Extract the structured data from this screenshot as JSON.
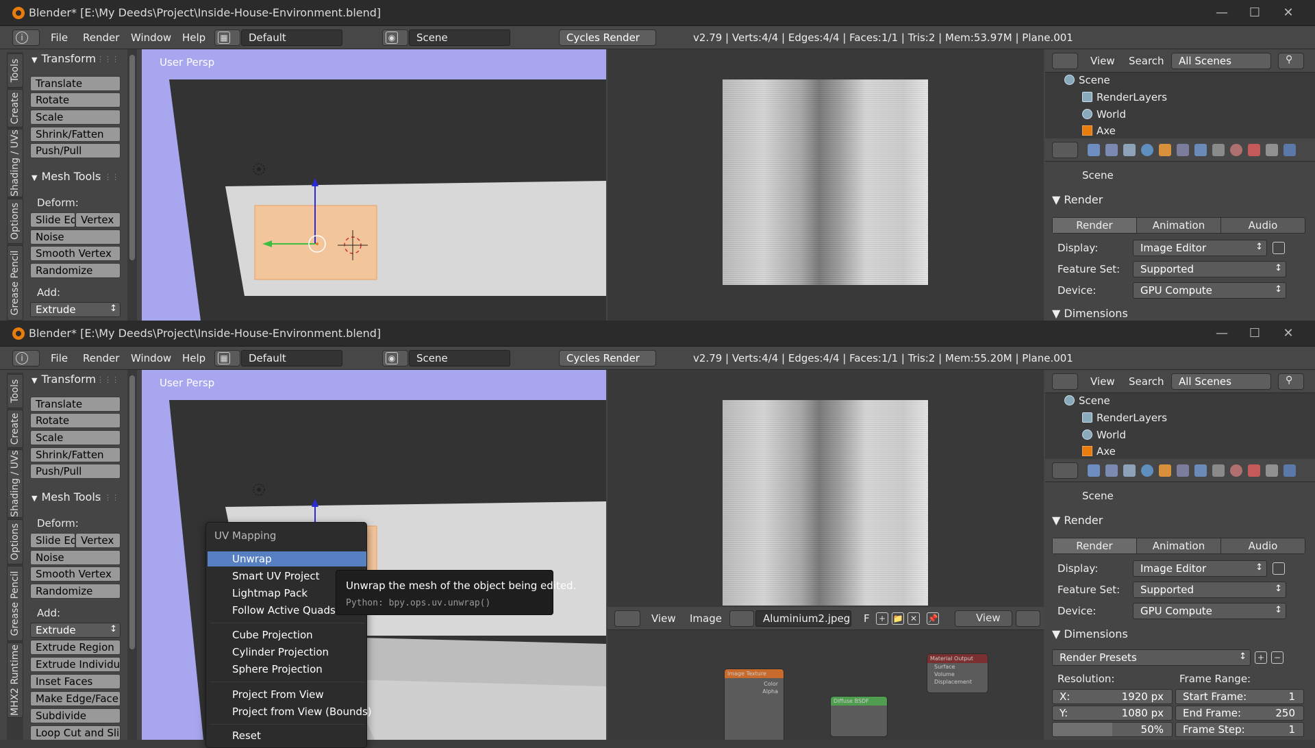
{
  "window1": {
    "title": "Blender* [E:\\My Deeds\\Project\\Inside-House-Environment.blend]",
    "menu": [
      "File",
      "Render",
      "Window",
      "Help"
    ],
    "layout": "Default",
    "scene": "Scene",
    "engine": "Cycles Render",
    "stats": "v2.79 | Verts:4/4 | Edges:4/4 | Faces:1/1 | Tris:2 | Mem:53.97M | Plane.001"
  },
  "window2": {
    "title": "Blender* [E:\\My Deeds\\Project\\Inside-House-Environment.blend]",
    "menu": [
      "File",
      "Render",
      "Window",
      "Help"
    ],
    "layout": "Default",
    "scene": "Scene",
    "engine": "Cycles Render",
    "stats": "v2.79 | Verts:4/4 | Edges:4/4 | Faces:1/1 | Tris:2 | Mem:55.20M | Plane.001"
  },
  "tool_tabs": [
    "Tools",
    "Create",
    "Shading / UVs",
    "Options",
    "Grease Pencil",
    "MHX2 Runtime"
  ],
  "tool_shelf": {
    "transform_header": "Transform",
    "transform_buttons": [
      "Translate",
      "Rotate",
      "Scale",
      "Shrink/Fatten",
      "Push/Pull"
    ],
    "mesh_tools_header": "Mesh Tools",
    "deform_label": "Deform:",
    "slide_edge": "Slide Ed",
    "vertex": "Vertex",
    "deform_buttons": [
      "Noise",
      "Smooth Vertex",
      "Randomize"
    ],
    "add_label": "Add:",
    "extrude": "Extrude",
    "add_buttons": [
      "Extrude Region",
      "Extrude Individual",
      "Inset Faces",
      "Make Edge/Face",
      "Subdivide",
      "Loop Cut and Sli..."
    ]
  },
  "viewport": {
    "label": "User Persp"
  },
  "outliner": {
    "view": "View",
    "search": "Search",
    "filter": "All Scenes",
    "rows": [
      "Scene",
      "RenderLayers",
      "World",
      "Axe"
    ]
  },
  "properties": {
    "context": "Scene",
    "render_section": "Render",
    "tabs": [
      "Render",
      "Animation",
      "Audio"
    ],
    "display_label": "Display:",
    "display_value": "Image Editor",
    "feature_set_label": "Feature Set:",
    "feature_set_value": "Supported",
    "device_label": "Device:",
    "device_value": "GPU Compute",
    "dimensions_section": "Dimensions",
    "render_presets": "Render Presets",
    "resolution_label": "Resolution:",
    "res_x_label": "X:",
    "res_x_value": "1920 px",
    "res_y_label": "Y:",
    "res_y_value": "1080 px",
    "res_pct": "50%",
    "frame_range_label": "Frame Range:",
    "start_frame_label": "Start Frame:",
    "start_frame_value": "1",
    "end_frame_label": "End Frame:",
    "end_frame_value": "250",
    "frame_step_label": "Frame Step:",
    "frame_step_value": "1"
  },
  "image_editor": {
    "view": "View",
    "image": "Image",
    "image_name": "Aluminium2.jpeg",
    "fake_user": "F",
    "view2": "View"
  },
  "nodes": {
    "image_texture": "Image Texture",
    "image_texture_outputs": [
      "Color",
      "Alpha"
    ],
    "diffuse": "Diffuse BSDF",
    "material_output": "Material Output",
    "material_output_inputs": [
      "Surface",
      "Volume",
      "Displacement"
    ]
  },
  "uv_menu": {
    "title": "UV Mapping",
    "items_group1": [
      "Unwrap",
      "Smart UV Project",
      "Lightmap Pack",
      "Follow Active Quads"
    ],
    "items_group2": [
      "Cube Projection",
      "Cylinder Projection",
      "Sphere Projection"
    ],
    "items_group3": [
      "Project From View",
      "Project from View (Bounds)"
    ],
    "items_group4": [
      "Reset"
    ]
  },
  "tooltip": {
    "description": "Unwrap the mesh of the object being edited.",
    "python": "Python: bpy.ops.uv.unwrap()"
  },
  "colors": {
    "viewport_bg": "#a8a6ef",
    "selected_face": "#f2c59b",
    "menu_highlight": "#5680c2",
    "blender_orange": "#e87d0d"
  }
}
